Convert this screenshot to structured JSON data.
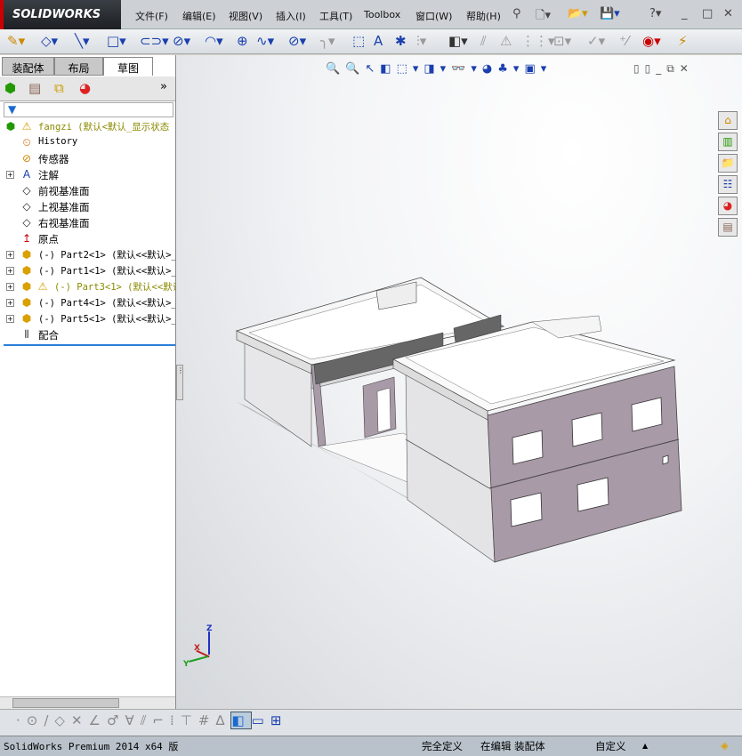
{
  "app": {
    "logo": "SOLIDWORKS"
  },
  "menu": [
    "文件(F)",
    "编辑(E)",
    "视图(V)",
    "插入(I)",
    "工具(T)",
    "Toolbox",
    "窗口(W)",
    "帮助(H)"
  ],
  "panel": {
    "tabs": [
      "装配体",
      "布局",
      "草图"
    ],
    "active_tab": "草图",
    "more": "»",
    "tree": [
      {
        "label": "fangzi  (默认<默认_显示状态",
        "icon": "assembly-warning-icon",
        "warn": true
      },
      {
        "label": "History",
        "icon": "history-icon"
      },
      {
        "label": "传感器",
        "icon": "sensor-icon"
      },
      {
        "label": "注解",
        "icon": "annotation-icon",
        "expand": true
      },
      {
        "label": "前视基准面",
        "icon": "plane-icon"
      },
      {
        "label": "上视基准面",
        "icon": "plane-icon"
      },
      {
        "label": "右视基准面",
        "icon": "plane-icon"
      },
      {
        "label": "原点",
        "icon": "origin-icon"
      },
      {
        "label": "(-) Part2<1> (默认<<默认>_",
        "icon": "part-icon",
        "expand": true
      },
      {
        "label": "(-) Part1<1> (默认<<默认>_",
        "icon": "part-icon",
        "expand": true
      },
      {
        "label": "(-) Part3<1> (默认<<默认",
        "icon": "part-icon",
        "expand": true,
        "warn": true
      },
      {
        "label": "(-) Part4<1> (默认<<默认>_",
        "icon": "part-icon",
        "expand": true
      },
      {
        "label": "(-) Part5<1> (默认<<默认>_",
        "icon": "part-icon",
        "expand": true
      },
      {
        "label": "配合",
        "icon": "mates-icon"
      }
    ]
  },
  "triad": {
    "x": "X",
    "y": "Y",
    "z": "Z"
  },
  "status": {
    "product": "SolidWorks Premium 2014 x64 版",
    "defined": "完全定义",
    "editing": "在编辑 装配体",
    "units": "自定义",
    "units_arrow": "▲"
  },
  "colors": {
    "accent": "#1a3fae",
    "wall": "#a99aa8",
    "warning": "#f5c400"
  }
}
